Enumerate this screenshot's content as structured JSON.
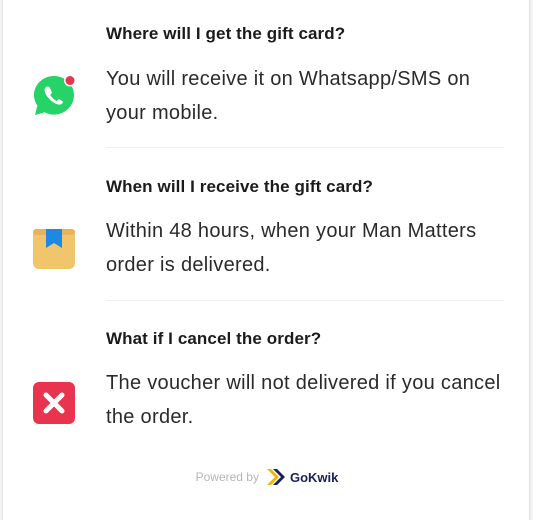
{
  "faq": [
    {
      "question": "Where will I get the gift card?",
      "answer": "You will receive it on Whatsapp/SMS on your mobile.",
      "icon": "whatsapp-icon",
      "icon_color": "#25D366"
    },
    {
      "question": "When will I receive the gift card?",
      "answer": "Within 48 hours, when your Man Matters order is delivered.",
      "icon": "package-icon",
      "icon_color": "#F0C56B"
    },
    {
      "question": "What if I cancel the order?",
      "answer": "The voucher will not delivered if you cancel the order.",
      "icon": "cancel-x-icon",
      "icon_color": "#E8344E"
    }
  ],
  "footer": {
    "powered_by": "Powered by",
    "brand": "GoKwik",
    "brand_color": "#1A1F5C",
    "brand_accent": "#F5B400"
  }
}
